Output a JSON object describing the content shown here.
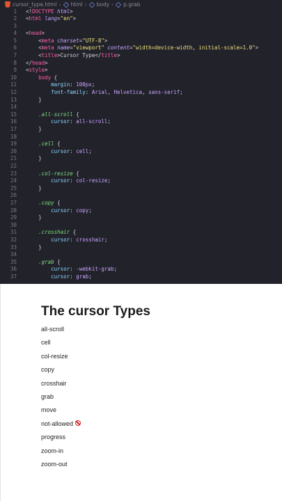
{
  "breadcrumb": {
    "file": "cursor_type.html",
    "items": [
      "html",
      "body",
      "p.grab"
    ]
  },
  "editor": {
    "lines": [
      {
        "n": "1",
        "html": "<span class='tok-punct'>&lt;!</span><span class='tok-tag'>DOCTYPE</span> <span class='tok-attr'>html</span><span class='tok-punct'>&gt;</span>"
      },
      {
        "n": "2",
        "html": "<span class='tok-punct'>&lt;</span><span class='tok-tag'>html</span> <span class='tok-attr'>lang</span><span class='tok-punct'>=</span><span class='tok-str'>\"en\"</span><span class='tok-punct'>&gt;</span>"
      },
      {
        "n": "3",
        "html": ""
      },
      {
        "n": "4",
        "html": "<span class='tok-punct'>&lt;</span><span class='tok-tag'>head</span><span class='tok-punct'>&gt;</span>"
      },
      {
        "n": "5",
        "html": "    <span class='tok-punct'>&lt;</span><span class='tok-tag'>meta</span> <span class='tok-attr'>charset</span><span class='tok-punct'>=</span><span class='tok-str'>\"UTF-8\"</span><span class='tok-punct'>&gt;</span>"
      },
      {
        "n": "6",
        "html": "    <span class='tok-punct'>&lt;</span><span class='tok-tag'>meta</span> <span class='tok-attr'>name</span><span class='tok-punct'>=</span><span class='tok-str'>\"viewport\"</span> <span class='tok-attr'>content</span><span class='tok-punct'>=</span><span class='tok-str'>\"width=device-width, initial-scale=1.0\"</span><span class='tok-punct'>&gt;</span>"
      },
      {
        "n": "7",
        "html": "    <span class='tok-punct'>&lt;</span><span class='tok-tag'>title</span><span class='tok-punct'>&gt;</span><span class='tok-plain'>Cursor Type</span><span class='tok-punct'>&lt;/</span><span class='tok-tag'>title</span><span class='tok-punct'>&gt;</span>"
      },
      {
        "n": "8",
        "html": "<span class='tok-punct'>&lt;/</span><span class='tok-tag'>head</span><span class='tok-punct'>&gt;</span>"
      },
      {
        "n": "9",
        "html": "<span class='tok-punct'>&lt;</span><span class='tok-tag'>style</span><span class='tok-punct'>&gt;</span>"
      },
      {
        "n": "10",
        "html": "    <span class='tok-tag'>body</span> <span class='tok-punct'>{</span>"
      },
      {
        "n": "11",
        "html": "        <span class='tok-prop'>margin</span><span class='tok-punct'>:</span> <span class='tok-val'>100px</span><span class='tok-punct'>;</span>"
      },
      {
        "n": "12",
        "html": "        <span class='tok-prop'>font-family</span><span class='tok-punct'>:</span> <span class='tok-val'>Arial</span><span class='tok-punct'>,</span> <span class='tok-val'>Helvetica</span><span class='tok-punct'>,</span> <span class='tok-val'>sans-serif</span><span class='tok-punct'>;</span>"
      },
      {
        "n": "13",
        "html": "    <span class='tok-punct'>}</span>"
      },
      {
        "n": "14",
        "html": ""
      },
      {
        "n": "15",
        "html": "    <span class='tok-sel'>.all-scroll</span> <span class='tok-punct'>{</span>"
      },
      {
        "n": "16",
        "html": "        <span class='tok-prop'>cursor</span><span class='tok-punct'>:</span> <span class='tok-val'>all-scroll</span><span class='tok-punct'>;</span>"
      },
      {
        "n": "17",
        "html": "    <span class='tok-punct'>}</span>"
      },
      {
        "n": "18",
        "html": ""
      },
      {
        "n": "19",
        "html": "    <span class='tok-sel'>.cell</span> <span class='tok-punct'>{</span>"
      },
      {
        "n": "20",
        "html": "        <span class='tok-prop'>cursor</span><span class='tok-punct'>:</span> <span class='tok-val'>cell</span><span class='tok-punct'>;</span>"
      },
      {
        "n": "21",
        "html": "    <span class='tok-punct'>}</span>"
      },
      {
        "n": "22",
        "html": ""
      },
      {
        "n": "23",
        "html": "    <span class='tok-sel'>.col-resize</span> <span class='tok-punct'>{</span>"
      },
      {
        "n": "24",
        "html": "        <span class='tok-prop'>cursor</span><span class='tok-punct'>:</span> <span class='tok-val'>col-resize</span><span class='tok-punct'>;</span>"
      },
      {
        "n": "25",
        "html": "    <span class='tok-punct'>}</span>"
      },
      {
        "n": "26",
        "html": ""
      },
      {
        "n": "27",
        "html": "    <span class='tok-sel'>.copy</span> <span class='tok-punct'>{</span>"
      },
      {
        "n": "28",
        "html": "        <span class='tok-prop'>cursor</span><span class='tok-punct'>:</span> <span class='tok-val'>copy</span><span class='tok-punct'>;</span>"
      },
      {
        "n": "29",
        "html": "    <span class='tok-punct'>}</span>"
      },
      {
        "n": "30",
        "html": ""
      },
      {
        "n": "31",
        "html": "    <span class='tok-sel'>.crosshair</span> <span class='tok-punct'>{</span>"
      },
      {
        "n": "32",
        "html": "        <span class='tok-prop'>cursor</span><span class='tok-punct'>:</span> <span class='tok-val'>crosshair</span><span class='tok-punct'>;</span>"
      },
      {
        "n": "33",
        "html": "    <span class='tok-punct'>}</span>"
      },
      {
        "n": "34",
        "html": ""
      },
      {
        "n": "35",
        "html": "    <span class='tok-sel'>.grab</span> <span class='tok-punct'>{</span>"
      },
      {
        "n": "36",
        "html": "        <span class='tok-prop'>cursor</span><span class='tok-punct'>:</span> <span class='tok-val'>-webkit-grab</span><span class='tok-punct'>;</span>"
      },
      {
        "n": "37",
        "html": "        <span class='tok-prop'>cursor</span><span class='tok-punct'>:</span> <span class='tok-val'>grab</span><span class='tok-punct'>;</span>"
      }
    ]
  },
  "preview": {
    "heading": "The cursor Types",
    "items": [
      "all-scroll",
      "cell",
      "col-resize",
      "copy",
      "crosshair",
      "grab",
      "move",
      "not-allowed",
      "progress",
      "zoom-in",
      "zoom-out"
    ],
    "not_allowed_icon": "not-allowed-cursor-icon"
  }
}
